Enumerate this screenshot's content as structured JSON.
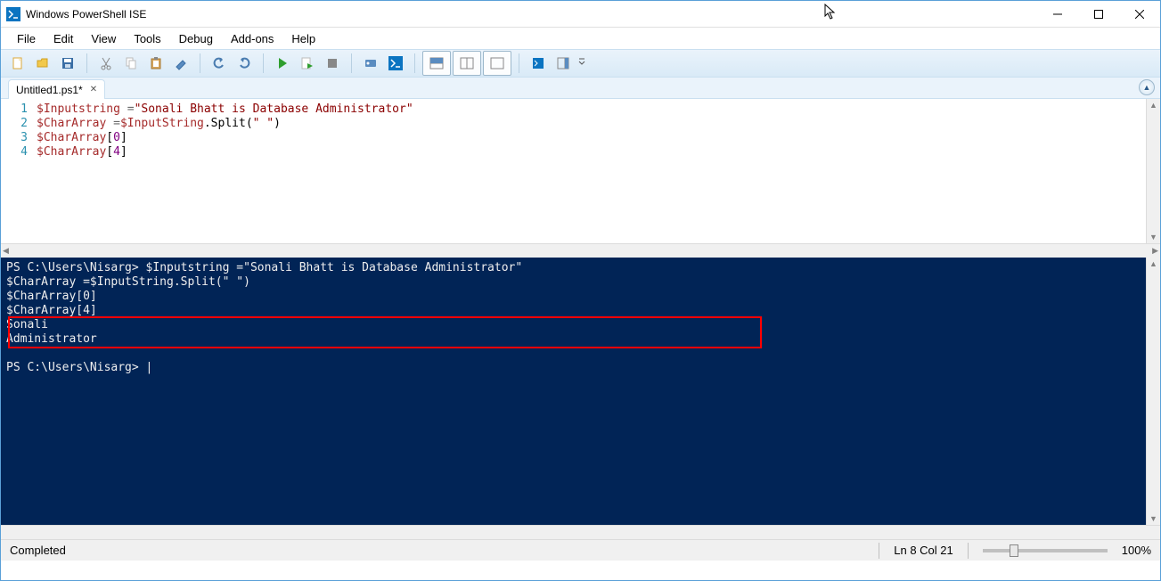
{
  "window": {
    "title": "Windows PowerShell ISE"
  },
  "menu": {
    "items": [
      "File",
      "Edit",
      "View",
      "Tools",
      "Debug",
      "Add-ons",
      "Help"
    ]
  },
  "tab": {
    "label": "Untitled1.ps1*"
  },
  "editor": {
    "line_numbers": [
      "1",
      "2",
      "3",
      "4"
    ],
    "lines": [
      {
        "var1": "$Inputstring",
        "op": " =",
        "str": "\"Sonali Bhatt is Database Administrator\""
      },
      {
        "var1": "$CharArray",
        "op": " =",
        "var2": "$InputString",
        "mem": ".Split(",
        "str": "\" \"",
        "close": ")"
      },
      {
        "var1": "$CharArray",
        "open": "[",
        "num": "0",
        "close": "]"
      },
      {
        "var1": "$CharArray",
        "open": "[",
        "num": "4",
        "close": "]"
      }
    ]
  },
  "console": {
    "line1_prompt": "PS C:\\Users\\Nisarg> ",
    "line1_cmd": "$Inputstring =\"Sonali Bhatt is Database Administrator\"",
    "line2": "$CharArray =$InputString.Split(\" \")",
    "line3": "$CharArray[0]",
    "line4": "$CharArray[4]",
    "out1": "Sonali",
    "out2": "Administrator",
    "blank": "",
    "prompt2": "PS C:\\Users\\Nisarg> ",
    "cursor": "|"
  },
  "status": {
    "message": "Completed",
    "position": "Ln 8  Col 21",
    "zoom": "100%"
  }
}
